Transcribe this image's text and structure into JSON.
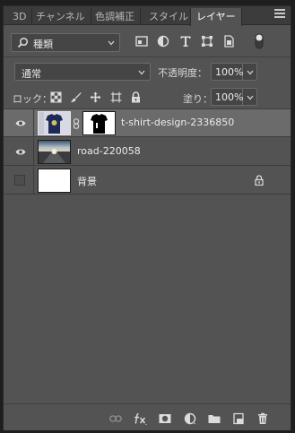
{
  "tabs": [
    {
      "label": "3D"
    },
    {
      "label": "チャンネル"
    },
    {
      "label": "色調補正"
    },
    {
      "label": "スタイル"
    },
    {
      "label": "レイヤー"
    }
  ],
  "filter": {
    "kind_label": "種類",
    "icons": [
      "pixel-filter-icon",
      "adjustment-filter-icon",
      "type-filter-icon",
      "shape-filter-icon",
      "smart-object-filter-icon"
    ]
  },
  "blend": {
    "mode": "通常",
    "opacity_label": "不透明度：",
    "opacity_value": "100%"
  },
  "lock": {
    "label": "ロック：",
    "fill_label": "塗り：",
    "fill_value": "100%"
  },
  "layers": [
    {
      "name": "t-shirt-design-2336850",
      "visible": true,
      "selected": true
    },
    {
      "name": "road-220058",
      "visible": true,
      "selected": false
    },
    {
      "name": "背景",
      "visible": false,
      "selected": false,
      "locked": true
    }
  ],
  "colors": {
    "panel_bg": "#535353",
    "selected_row": "#6b6b6b"
  }
}
